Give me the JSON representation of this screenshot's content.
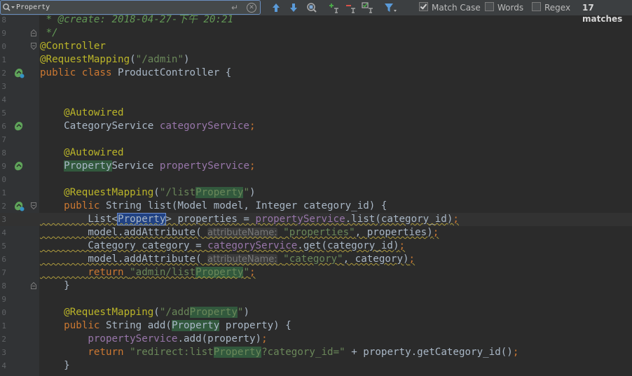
{
  "find_bar": {
    "query": "Property",
    "enter_icon": "↵",
    "clear_icon": "✕",
    "match_case": {
      "label": "Match Case",
      "checked": true
    },
    "words": {
      "label": "Words",
      "checked": false
    },
    "regex": {
      "label": "Regex",
      "checked": false
    },
    "match_count": "17 matches",
    "icons": [
      "search-history-icon",
      "previous-occurrence-icon",
      "next-occurrence-icon",
      "find-all-icon",
      "add-occurrence-icon",
      "remove-occurrence-icon",
      "select-all-occurrences-icon",
      "filter-icon"
    ]
  },
  "editor": {
    "line_numbers": [
      "8",
      "9",
      "0",
      "1",
      "2",
      "3",
      "4",
      "5",
      "6",
      "7",
      "8",
      "9",
      "0",
      "1",
      "2",
      "3",
      "4",
      "5",
      "6",
      "7",
      "8",
      "9",
      "0",
      "1",
      "2",
      "3",
      "4"
    ],
    "lines": [
      [
        {
          "t": " * ",
          "c": "cmt"
        },
        {
          "t": "@create:",
          "c": "cmt"
        },
        {
          "t": " 2018-04-27-下午 20:21",
          "c": "cmt"
        }
      ],
      [
        {
          "t": " */",
          "c": "cmt"
        }
      ],
      [
        {
          "t": "@Controller",
          "c": "ann"
        }
      ],
      [
        {
          "t": "@RequestMapping",
          "c": "ann"
        },
        {
          "t": "(",
          "c": ""
        },
        {
          "t": "\"/admin\"",
          "c": "str"
        },
        {
          "t": ")",
          "c": ""
        }
      ],
      [
        {
          "t": "public class ",
          "c": "kw"
        },
        {
          "t": "ProductController {",
          "c": ""
        }
      ],
      [],
      [],
      [
        {
          "t": "    "
        },
        {
          "t": "@Autowired",
          "c": "ann"
        }
      ],
      [
        {
          "t": "    CategoryService ",
          "c": ""
        },
        {
          "t": "categoryService",
          "c": "fld"
        },
        {
          "t": ";",
          "c": "kw"
        }
      ],
      [],
      [
        {
          "t": "    "
        },
        {
          "t": "@Autowired",
          "c": "ann"
        }
      ],
      [
        {
          "t": "    "
        },
        {
          "t": "Property",
          "c": "hl"
        },
        {
          "t": "Service ",
          "c": ""
        },
        {
          "t": "propertyService",
          "c": "fld"
        },
        {
          "t": ";",
          "c": "kw"
        }
      ],
      [],
      [
        {
          "t": "    "
        },
        {
          "t": "@RequestMapping",
          "c": "ann"
        },
        {
          "t": "(",
          "c": ""
        },
        {
          "t": "\"/list",
          "c": "str"
        },
        {
          "t": "Property",
          "c": "str hl"
        },
        {
          "t": "\"",
          "c": "str"
        },
        {
          "t": ")",
          "c": ""
        }
      ],
      [
        {
          "t": "    "
        },
        {
          "t": "public ",
          "c": "kw"
        },
        {
          "t": "String list(Model model, Integer category_id) {",
          "c": ""
        }
      ],
      [
        {
          "t": "        List<",
          "c": ""
        },
        {
          "t": "Property",
          "c": "hlcur"
        },
        {
          "t": "> properties = ",
          "c": ""
        },
        {
          "t": "propertyService",
          "c": "fld"
        },
        {
          "t": ".list(category_id)",
          "c": ""
        },
        {
          "t": ";",
          "c": "kw"
        }
      ],
      [
        {
          "t": "        model.addAttribute( ",
          "c": ""
        },
        {
          "t": "attributeName:",
          "c": "hint"
        },
        {
          "t": " ",
          "c": ""
        },
        {
          "t": "\"properties\"",
          "c": "str"
        },
        {
          "t": ", properties)",
          "c": ""
        },
        {
          "t": ";",
          "c": "kw"
        }
      ],
      [
        {
          "t": "        Category category = ",
          "c": ""
        },
        {
          "t": "categoryService",
          "c": "fld"
        },
        {
          "t": ".get(category_id)",
          "c": ""
        },
        {
          "t": ";",
          "c": "kw"
        }
      ],
      [
        {
          "t": "        model.addAttribute( ",
          "c": ""
        },
        {
          "t": "attributeName:",
          "c": "hint"
        },
        {
          "t": " ",
          "c": ""
        },
        {
          "t": "\"category\"",
          "c": "str"
        },
        {
          "t": ", category)",
          "c": ""
        },
        {
          "t": ";",
          "c": "kw"
        }
      ],
      [
        {
          "t": "        "
        },
        {
          "t": "return ",
          "c": "kw"
        },
        {
          "t": "\"admin/list",
          "c": "str"
        },
        {
          "t": "Property",
          "c": "str hl"
        },
        {
          "t": "\"",
          "c": "str"
        },
        {
          "t": ";",
          "c": "kw"
        }
      ],
      [
        {
          "t": "    }",
          "c": ""
        }
      ],
      [],
      [
        {
          "t": "    "
        },
        {
          "t": "@RequestMapping",
          "c": "ann"
        },
        {
          "t": "(",
          "c": ""
        },
        {
          "t": "\"/add",
          "c": "str"
        },
        {
          "t": "Property",
          "c": "str hl"
        },
        {
          "t": "\"",
          "c": "str"
        },
        {
          "t": ")",
          "c": ""
        }
      ],
      [
        {
          "t": "    "
        },
        {
          "t": "public ",
          "c": "kw"
        },
        {
          "t": "String add(",
          "c": ""
        },
        {
          "t": "Property",
          "c": "hl"
        },
        {
          "t": " property) {",
          "c": ""
        }
      ],
      [
        {
          "t": "        "
        },
        {
          "t": "propertyService",
          "c": "fld"
        },
        {
          "t": ".add(property)",
          "c": ""
        },
        {
          "t": ";",
          "c": "kw"
        }
      ],
      [
        {
          "t": "        "
        },
        {
          "t": "return ",
          "c": "kw"
        },
        {
          "t": "\"redirect:list",
          "c": "str"
        },
        {
          "t": "Property",
          "c": "str hl"
        },
        {
          "t": "?category_id=\"",
          "c": "str"
        },
        {
          "t": " + property.getCategory_id()",
          "c": ""
        },
        {
          "t": ";",
          "c": "kw"
        }
      ],
      [
        {
          "t": "    }",
          "c": ""
        }
      ]
    ]
  }
}
